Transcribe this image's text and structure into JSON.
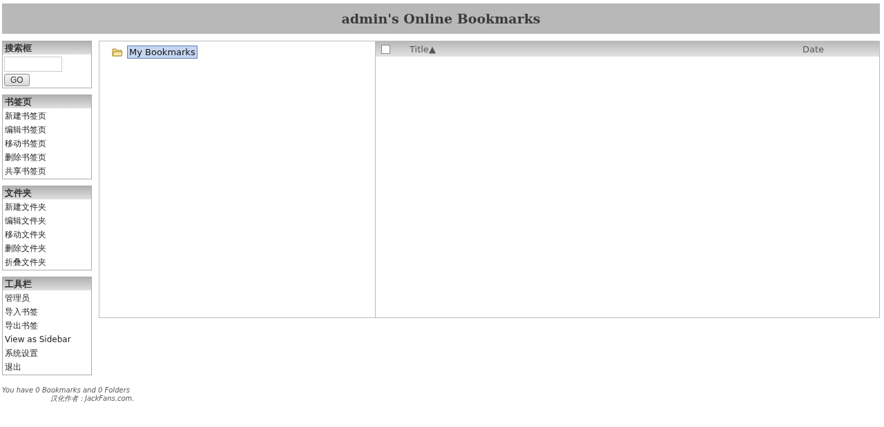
{
  "header": {
    "title": "admin's Online Bookmarks"
  },
  "sidebar": [
    {
      "kind": "search",
      "title": "搜索框",
      "button": "GO"
    },
    {
      "kind": "links",
      "title": "书签页",
      "items": [
        "新建书签页",
        "编辑书签页",
        "移动书签页",
        "删除书签页",
        "共享书签页"
      ]
    },
    {
      "kind": "links",
      "title": "文件夹",
      "items": [
        "新建文件夹",
        "编辑文件夹",
        "移动文件夹",
        "删除文件夹",
        "折叠文件夹"
      ]
    },
    {
      "kind": "links",
      "title": "工具栏",
      "items": [
        "管理员",
        "导入书签",
        "导出书签",
        "View as Sidebar",
        "系统设置",
        "退出"
      ]
    }
  ],
  "tree": [
    {
      "label": "My Bookmarks",
      "selected": true
    }
  ],
  "table": {
    "select_all": {
      "checked": false
    },
    "columns": [
      {
        "label": "Title",
        "sort": "▲"
      },
      {
        "label": "Date"
      }
    ]
  },
  "footer": {
    "summary": "You have 0 Bookmarks and 0 Folders",
    "credit": "汉化作者：JackFans.com."
  }
}
